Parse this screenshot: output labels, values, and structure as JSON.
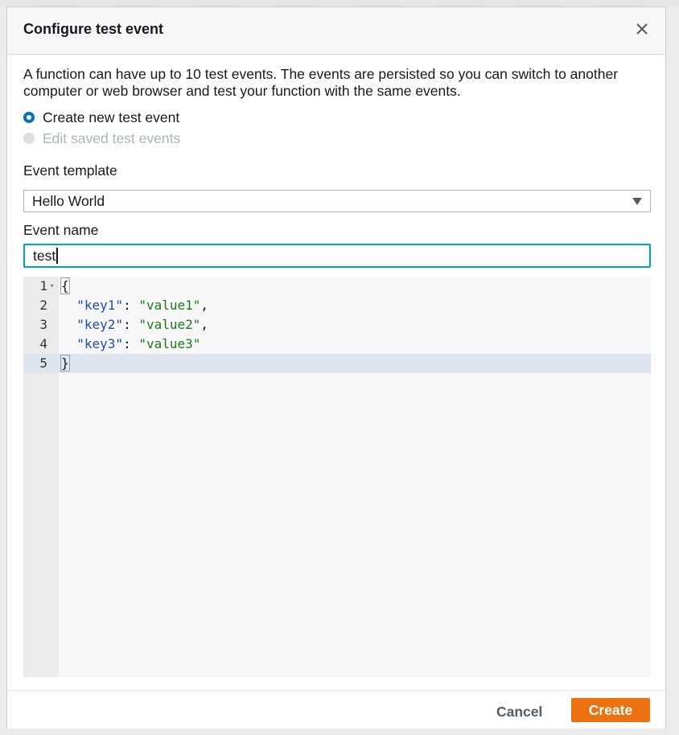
{
  "dialog": {
    "title": "Configure test event",
    "description": "A function can have up to 10 test events. The events are persisted so you can switch to another computer or web browser and test your function with the same events."
  },
  "mode_options": [
    {
      "label": "Create new test event",
      "selected": true,
      "disabled": false
    },
    {
      "label": "Edit saved test events",
      "selected": false,
      "disabled": true
    }
  ],
  "event_template": {
    "label": "Event template",
    "value": "Hello World"
  },
  "event_name": {
    "label": "Event name",
    "value": "test"
  },
  "editor": {
    "line_numbers": [
      "1",
      "2",
      "3",
      "4",
      "5"
    ],
    "active_line": 5,
    "lines": [
      {
        "open": "{"
      },
      {
        "key": "\"key1\"",
        "sep": ": ",
        "value": "\"value1\"",
        "end": ","
      },
      {
        "key": "\"key2\"",
        "sep": ": ",
        "value": "\"value2\"",
        "end": ","
      },
      {
        "key": "\"key3\"",
        "sep": ": ",
        "value": "\"value3\"",
        "end": ""
      },
      {
        "close": "}"
      }
    ]
  },
  "footer": {
    "cancel_label": "Cancel",
    "create_label": "Create"
  },
  "colors": {
    "primary_button": "#ec7211",
    "radio_selected": "#0073bb",
    "input_focus": "#00a1c9"
  }
}
